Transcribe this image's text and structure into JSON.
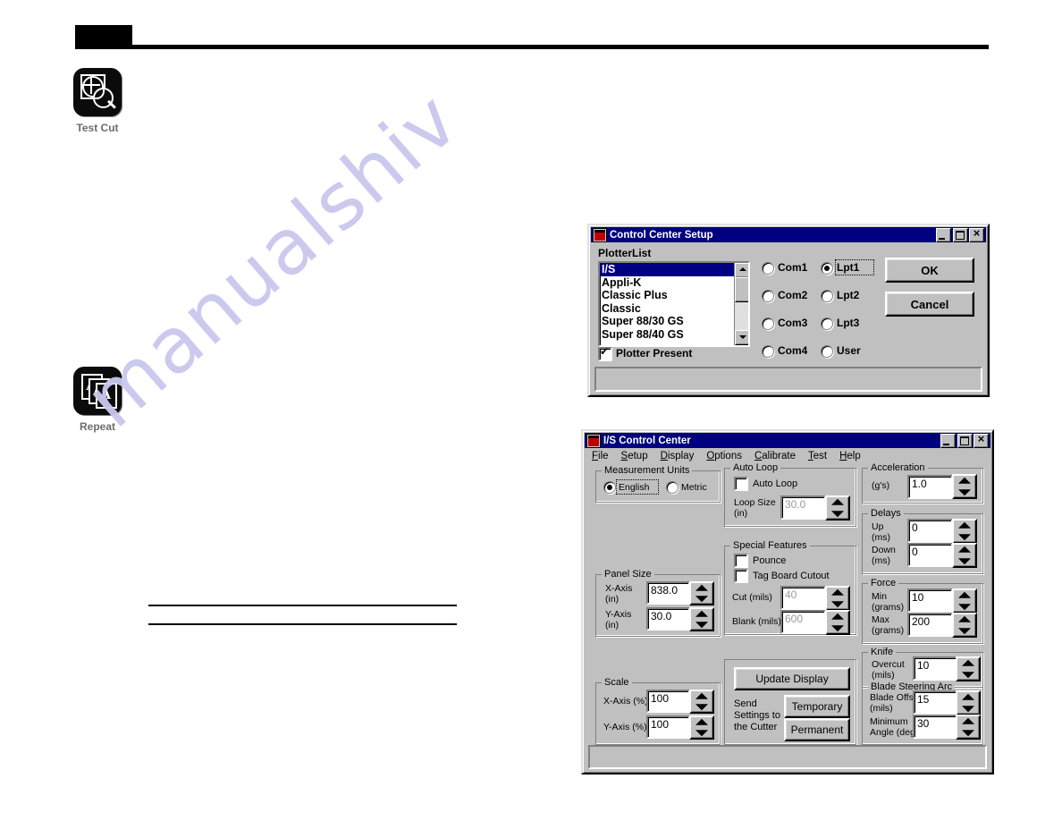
{
  "page": {
    "header_block_label": "",
    "watermark_text": "manualshiv"
  },
  "icons": [
    {
      "name": "test-cut",
      "label": "Test Cut"
    },
    {
      "name": "repeat",
      "label": "Repeat"
    }
  ],
  "setup_dialog": {
    "title": "Control Center Setup",
    "titlebar_icon": "app-icon",
    "window_buttons": {
      "minimize": "_",
      "maximize": "□",
      "close": "×"
    },
    "plotter_list_label": "PlotterList",
    "plotter_list": [
      {
        "label": "I/S",
        "selected": true
      },
      {
        "label": "Appli-K",
        "selected": false
      },
      {
        "label": "Classic Plus",
        "selected": false
      },
      {
        "label": "Classic",
        "selected": false
      },
      {
        "label": "Super 88/30 GS",
        "selected": false
      },
      {
        "label": "Super 88/40 GS",
        "selected": false
      }
    ],
    "plotter_present": {
      "label": "Plotter Present",
      "checked": true
    },
    "ports_column_1": [
      {
        "label": "Com1",
        "selected": false
      },
      {
        "label": "Com2",
        "selected": false
      },
      {
        "label": "Com3",
        "selected": false
      },
      {
        "label": "Com4",
        "selected": false
      }
    ],
    "ports_column_2": [
      {
        "label": "Lpt1",
        "selected": true
      },
      {
        "label": "Lpt2",
        "selected": false
      },
      {
        "label": "Lpt3",
        "selected": false
      },
      {
        "label": "User",
        "selected": false
      }
    ],
    "ok_label": "OK",
    "cancel_label": "Cancel"
  },
  "control_center": {
    "title": "I/S Control Center",
    "menu": [
      {
        "label": "File",
        "accel": "F"
      },
      {
        "label": "Setup",
        "accel": "S"
      },
      {
        "label": "Display",
        "accel": "D"
      },
      {
        "label": "Options",
        "accel": "O"
      },
      {
        "label": "Calibrate",
        "accel": "C"
      },
      {
        "label": "Test",
        "accel": "T"
      },
      {
        "label": "Help",
        "accel": "H"
      }
    ],
    "measurement_units": {
      "title": "Measurement Units",
      "options": [
        {
          "label": "English",
          "selected": true
        },
        {
          "label": "Metric",
          "selected": false
        }
      ]
    },
    "auto_loop": {
      "title": "Auto Loop",
      "checkbox_label": "Auto Loop",
      "checkbox_checked": false,
      "loop_size_label": "Loop Size",
      "loop_size_units": "(in)",
      "loop_size_value": "30.0",
      "loop_size_disabled": true
    },
    "special_features": {
      "title": "Special Features",
      "pounce_label": "Pounce",
      "pounce_checked": false,
      "tag_board_label": "Tag Board Cutout",
      "tag_board_checked": false,
      "cut_label": "Cut (mils)",
      "cut_value": "40",
      "cut_disabled": true,
      "blank_label": "Blank (mils)",
      "blank_value": "600",
      "blank_disabled": true
    },
    "panel_size": {
      "title": "Panel Size",
      "x_label": "X-Axis",
      "x_units": "(in)",
      "x_value": "838.0",
      "y_label": "Y-Axis",
      "y_units": "(in)",
      "y_value": "30.0"
    },
    "scale": {
      "title": "Scale",
      "x_label": "X-Axis (%)",
      "x_value": "100",
      "y_label": "Y-Axis (%)",
      "y_value": "100"
    },
    "actions": {
      "update_display_label": "Update Display",
      "send_settings_line1": "Send",
      "send_settings_line2": "Settings to",
      "send_settings_line3": "the Cutter",
      "temporary_label": "Temporary",
      "permanent_label": "Permanent"
    },
    "acceleration": {
      "title": "Acceleration",
      "units_label": "(g's)",
      "value": "1.0"
    },
    "delays": {
      "title": "Delays",
      "up_label": "Up",
      "up_units": "(ms)",
      "up_value": "0",
      "down_label": "Down",
      "down_units": "(ms)",
      "down_value": "0"
    },
    "force": {
      "title": "Force",
      "min_label": "Min",
      "min_units": "(grams)",
      "min_value": "10",
      "max_label": "Max",
      "max_units": "(grams)",
      "max_value": "200"
    },
    "knife": {
      "title": "Knife",
      "overcut_label": "Overcut",
      "overcut_units": "(mils)",
      "overcut_value": "10"
    },
    "blade_steering_arc": {
      "title": "Blade Steering Arc",
      "offset_label": "Blade Offset",
      "offset_units": "(mils)",
      "offset_value": "15",
      "angle_label": "Minimum",
      "angle_units": "Angle (deg)",
      "angle_value": "30"
    }
  }
}
